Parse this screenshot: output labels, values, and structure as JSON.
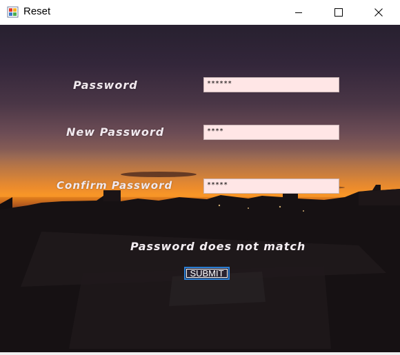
{
  "window": {
    "title": "Reset",
    "app_icon": "winforms-app-icon",
    "controls": {
      "minimize_icon": "minimize-icon",
      "maximize_icon": "maximize-icon",
      "close_icon": "close-icon"
    }
  },
  "form": {
    "password_label": "Password",
    "password_value": "******",
    "new_password_label": "New Password",
    "new_password_value": "****",
    "confirm_password_label": "Confirm Password",
    "confirm_password_value": "*****",
    "error_message": "Password does not match",
    "submit_label": "SUBMIT"
  },
  "colors": {
    "field_background": "#ffe6e6",
    "label_text": "#f1e9ee",
    "button_border": "#2b7fd6"
  }
}
